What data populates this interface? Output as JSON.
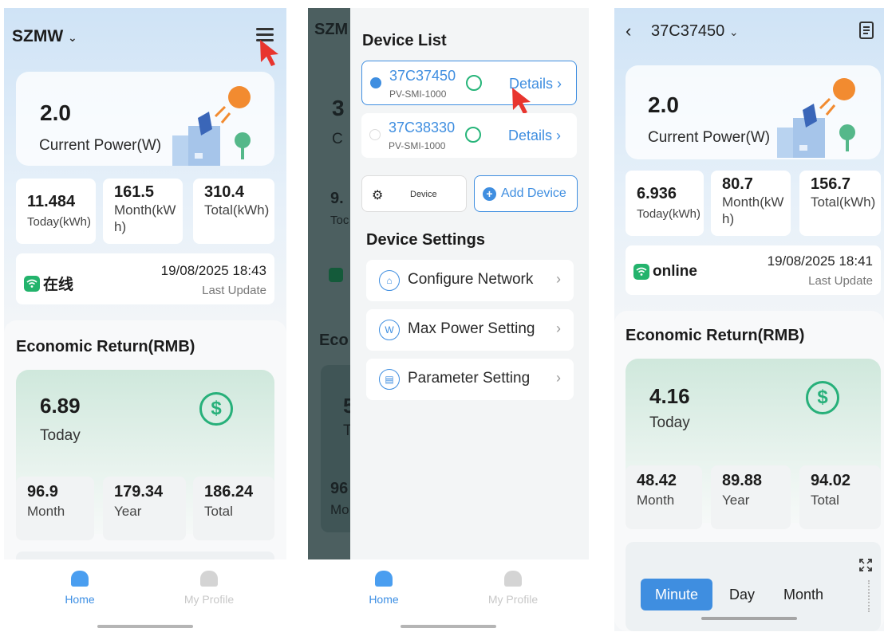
{
  "screen1": {
    "plant_name": "SZMW",
    "current_power": {
      "value": "2.0",
      "label": "Current Power(W)"
    },
    "stats": [
      {
        "value": "11.484",
        "label": "Today(kWh)"
      },
      {
        "value": "161.5",
        "label": "Month(kWh)"
      },
      {
        "value": "310.4",
        "label": "Total(kWh)"
      }
    ],
    "status": {
      "text": "在线",
      "timestamp": "19/08/2025 18:43",
      "timestamp_label": "Last Update"
    },
    "economic": {
      "title": "Economic Return(RMB)",
      "today": {
        "value": "6.89",
        "label": "Today"
      },
      "items": [
        {
          "value": "96.9",
          "label": "Month"
        },
        {
          "value": "179.34",
          "label": "Year"
        },
        {
          "value": "186.24",
          "label": "Total"
        }
      ]
    },
    "nav": {
      "home": "Home",
      "profile": "My Profile"
    }
  },
  "screen2": {
    "device_list_title": "Device List",
    "devices": [
      {
        "id": "37C37450",
        "model": "PV-SMI-1000",
        "details": "Details",
        "selected": true
      },
      {
        "id": "37C38330",
        "model": "PV-SMI-1000",
        "details": "Details",
        "selected": false
      }
    ],
    "device_button": "Device",
    "add_device_button": "Add Device",
    "settings_title": "Device Settings",
    "settings": [
      {
        "label": "Configure Network",
        "icon": "wifi-icon"
      },
      {
        "label": "Max Power Setting",
        "icon": "w-icon"
      },
      {
        "label": "Parameter Setting",
        "icon": "parameter-icon"
      }
    ],
    "behind": {
      "title_fragment": "SZM",
      "econ_fragment": "Eco",
      "val1": "9.",
      "lbl1": "Toc",
      "val2": "5",
      "lbl2": "T",
      "val3": "96",
      "lbl3": "Mo",
      "big": "3",
      "big_lbl": "C"
    },
    "nav": {
      "home": "Home",
      "profile": "My Profile"
    }
  },
  "screen3": {
    "device_id": "37C37450",
    "current_power": {
      "value": "2.0",
      "label": "Current Power(W)"
    },
    "stats": [
      {
        "value": "6.936",
        "label": "Today(kWh)"
      },
      {
        "value": "80.7",
        "label": "Month(kWh)"
      },
      {
        "value": "156.7",
        "label": "Total(kWh)"
      }
    ],
    "status": {
      "text": "online",
      "timestamp": "19/08/2025 18:41",
      "timestamp_label": "Last Update"
    },
    "economic": {
      "title": "Economic Return(RMB)",
      "today": {
        "value": "4.16",
        "label": "Today"
      },
      "items": [
        {
          "value": "48.42",
          "label": "Month"
        },
        {
          "value": "89.88",
          "label": "Year"
        },
        {
          "value": "94.02",
          "label": "Total"
        }
      ]
    },
    "segments": [
      "Minute",
      "Day",
      "Month"
    ]
  },
  "colors": {
    "accent": "#3f8ee0",
    "green": "#27b07a",
    "cursor": "#e8352e"
  }
}
